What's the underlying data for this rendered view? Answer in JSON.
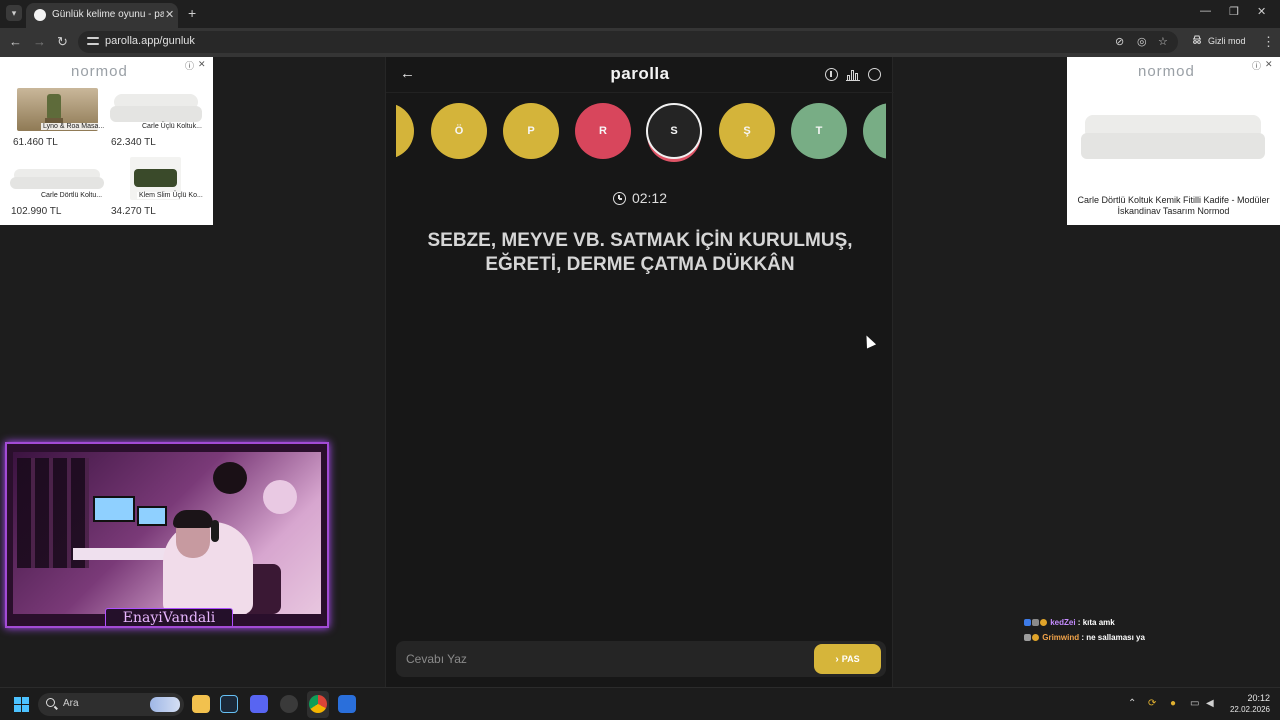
{
  "browser": {
    "tab_title": "Günlük kelime oyunu - parolla",
    "tab_close": "✕",
    "new_tab": "+",
    "url": "parolla.app/gunluk",
    "incognito_label": "Gizli mod",
    "window_controls": [
      "—",
      "❐",
      "✕"
    ],
    "nav_icons": [
      "arrow-left-icon",
      "arrow-right-icon",
      "reload-icon"
    ]
  },
  "ads": {
    "left": {
      "brand": "normod",
      "close": "✕",
      "products": [
        {
          "name": "Lyno & Roa Masa...",
          "price": "61.460 TL"
        },
        {
          "name": "Carle Üçlü Koltuk...",
          "price": "62.340 TL"
        },
        {
          "name": "Carle Dörtlü Koltu...",
          "price": "102.990 TL"
        },
        {
          "name": "Klem Slim Üçlü Ko...",
          "price": "34.270 TL"
        }
      ]
    },
    "right": {
      "brand": "normod",
      "close": "✕",
      "caption": "Carle Dörtlü Koltuk Kemik Fitilli Kadife - Modüler İskandinav Tasarım Normod"
    }
  },
  "webcam": {
    "name": "EnayiVandali"
  },
  "game": {
    "logo": "parolla",
    "back_icon": "←",
    "letters": [
      {
        "letter": "",
        "state": "yellow"
      },
      {
        "letter": "Ö",
        "state": "yellow"
      },
      {
        "letter": "P",
        "state": "yellow"
      },
      {
        "letter": "R",
        "state": "red"
      },
      {
        "letter": "S",
        "state": "current"
      },
      {
        "letter": "Ş",
        "state": "yellow"
      },
      {
        "letter": "T",
        "state": "green"
      },
      {
        "letter": "",
        "state": "green"
      }
    ],
    "timer": "02:12",
    "clue": "SEBZE, MEYVE VB. SATMAK İÇİN KURULMUŞ, EĞRETİ, DERME ÇATMA DÜKKÂN",
    "answer_placeholder": "Cevabı Yaz",
    "pass_label": "PAS",
    "pass_chevron": "›",
    "colors": {
      "yellow": "#d4b43a",
      "red": "#d8465c",
      "green": "#78ad85"
    }
  },
  "chat": [
    {
      "user": "kedZei",
      "sep": " : ",
      "message": "kıta amk"
    },
    {
      "user": "Grimwind",
      "sep": " : ",
      "message": "ne sallaması ya"
    }
  ],
  "taskbar": {
    "search_label": "Ara",
    "time": "20:12",
    "date": "22.02.2026",
    "tray_icons": [
      "chevron-up-icon",
      "sync-icon",
      "microphone-icon",
      "display-icon",
      "volume-icon"
    ]
  }
}
